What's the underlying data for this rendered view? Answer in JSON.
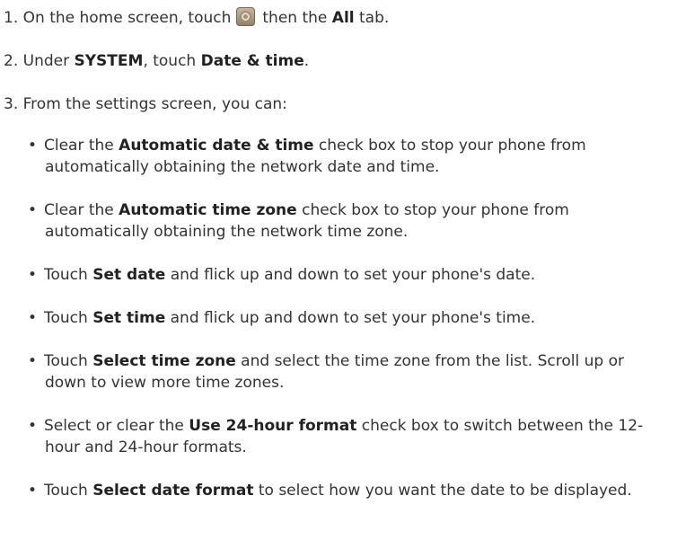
{
  "steps": [
    {
      "num": "1.",
      "pre": " On the home screen, touch",
      "icon": "settings-icon",
      "mid": "then the ",
      "bold": "All",
      "post": " tab."
    },
    {
      "num": "2.",
      "pre": " Under ",
      "bold1": "SYSTEM",
      "mid": ", touch ",
      "bold2": "Date & time",
      "post": "."
    },
    {
      "num": "3.",
      "text": " From the settings screen, you can:"
    }
  ],
  "bullets": [
    {
      "dot": "•",
      "pre": "Clear the ",
      "bold": "Automatic date & time",
      "post": " check box to stop your phone from",
      "cont": "automatically obtaining the network date and time."
    },
    {
      "dot": "•",
      "pre": "Clear the ",
      "bold": "Automatic time zone",
      "post": " check box to stop your phone from",
      "cont": "automatically obtaining the network time zone."
    },
    {
      "dot": "•",
      "pre": "Touch ",
      "bold": "Set date",
      "post": " and flick up and down to set your phone's date."
    },
    {
      "dot": "•",
      "pre": "Touch ",
      "bold": "Set time",
      "post": " and flick up and down to set your phone's time."
    },
    {
      "dot": "•",
      "pre": "Touch ",
      "bold": "Select time zone",
      "post": " and select the time zone from the list. Scroll up or",
      "cont": "down to view more time zones."
    },
    {
      "dot": "•",
      "pre": "Select or clear the ",
      "bold": "Use 24-hour format",
      "post": " check box to switch between the 12-",
      "cont": "hour and 24-hour formats."
    },
    {
      "dot": "•",
      "pre": "Touch ",
      "bold": "Select date format",
      "post": " to select how you want the date to be displayed."
    }
  ]
}
